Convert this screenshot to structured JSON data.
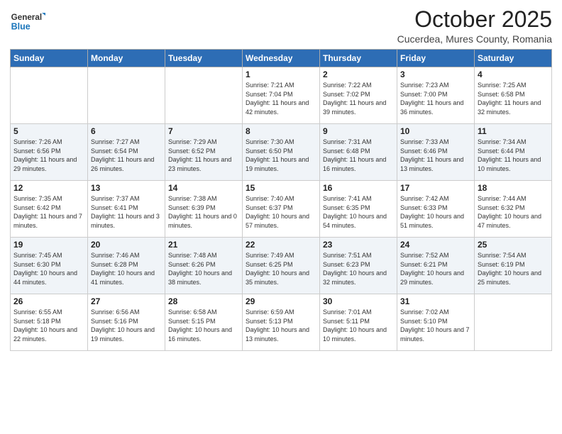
{
  "header": {
    "logo_line1": "General",
    "logo_line2": "Blue",
    "title": "October 2025",
    "subtitle": "Cucerdea, Mures County, Romania"
  },
  "columns": [
    "Sunday",
    "Monday",
    "Tuesday",
    "Wednesday",
    "Thursday",
    "Friday",
    "Saturday"
  ],
  "weeks": [
    [
      {
        "day": "",
        "sunrise": "",
        "sunset": "",
        "daylight": ""
      },
      {
        "day": "",
        "sunrise": "",
        "sunset": "",
        "daylight": ""
      },
      {
        "day": "",
        "sunrise": "",
        "sunset": "",
        "daylight": ""
      },
      {
        "day": "1",
        "sunrise": "Sunrise: 7:21 AM",
        "sunset": "Sunset: 7:04 PM",
        "daylight": "Daylight: 11 hours and 42 minutes."
      },
      {
        "day": "2",
        "sunrise": "Sunrise: 7:22 AM",
        "sunset": "Sunset: 7:02 PM",
        "daylight": "Daylight: 11 hours and 39 minutes."
      },
      {
        "day": "3",
        "sunrise": "Sunrise: 7:23 AM",
        "sunset": "Sunset: 7:00 PM",
        "daylight": "Daylight: 11 hours and 36 minutes."
      },
      {
        "day": "4",
        "sunrise": "Sunrise: 7:25 AM",
        "sunset": "Sunset: 6:58 PM",
        "daylight": "Daylight: 11 hours and 32 minutes."
      }
    ],
    [
      {
        "day": "5",
        "sunrise": "Sunrise: 7:26 AM",
        "sunset": "Sunset: 6:56 PM",
        "daylight": "Daylight: 11 hours and 29 minutes."
      },
      {
        "day": "6",
        "sunrise": "Sunrise: 7:27 AM",
        "sunset": "Sunset: 6:54 PM",
        "daylight": "Daylight: 11 hours and 26 minutes."
      },
      {
        "day": "7",
        "sunrise": "Sunrise: 7:29 AM",
        "sunset": "Sunset: 6:52 PM",
        "daylight": "Daylight: 11 hours and 23 minutes."
      },
      {
        "day": "8",
        "sunrise": "Sunrise: 7:30 AM",
        "sunset": "Sunset: 6:50 PM",
        "daylight": "Daylight: 11 hours and 19 minutes."
      },
      {
        "day": "9",
        "sunrise": "Sunrise: 7:31 AM",
        "sunset": "Sunset: 6:48 PM",
        "daylight": "Daylight: 11 hours and 16 minutes."
      },
      {
        "day": "10",
        "sunrise": "Sunrise: 7:33 AM",
        "sunset": "Sunset: 6:46 PM",
        "daylight": "Daylight: 11 hours and 13 minutes."
      },
      {
        "day": "11",
        "sunrise": "Sunrise: 7:34 AM",
        "sunset": "Sunset: 6:44 PM",
        "daylight": "Daylight: 11 hours and 10 minutes."
      }
    ],
    [
      {
        "day": "12",
        "sunrise": "Sunrise: 7:35 AM",
        "sunset": "Sunset: 6:42 PM",
        "daylight": "Daylight: 11 hours and 7 minutes."
      },
      {
        "day": "13",
        "sunrise": "Sunrise: 7:37 AM",
        "sunset": "Sunset: 6:41 PM",
        "daylight": "Daylight: 11 hours and 3 minutes."
      },
      {
        "day": "14",
        "sunrise": "Sunrise: 7:38 AM",
        "sunset": "Sunset: 6:39 PM",
        "daylight": "Daylight: 11 hours and 0 minutes."
      },
      {
        "day": "15",
        "sunrise": "Sunrise: 7:40 AM",
        "sunset": "Sunset: 6:37 PM",
        "daylight": "Daylight: 10 hours and 57 minutes."
      },
      {
        "day": "16",
        "sunrise": "Sunrise: 7:41 AM",
        "sunset": "Sunset: 6:35 PM",
        "daylight": "Daylight: 10 hours and 54 minutes."
      },
      {
        "day": "17",
        "sunrise": "Sunrise: 7:42 AM",
        "sunset": "Sunset: 6:33 PM",
        "daylight": "Daylight: 10 hours and 51 minutes."
      },
      {
        "day": "18",
        "sunrise": "Sunrise: 7:44 AM",
        "sunset": "Sunset: 6:32 PM",
        "daylight": "Daylight: 10 hours and 47 minutes."
      }
    ],
    [
      {
        "day": "19",
        "sunrise": "Sunrise: 7:45 AM",
        "sunset": "Sunset: 6:30 PM",
        "daylight": "Daylight: 10 hours and 44 minutes."
      },
      {
        "day": "20",
        "sunrise": "Sunrise: 7:46 AM",
        "sunset": "Sunset: 6:28 PM",
        "daylight": "Daylight: 10 hours and 41 minutes."
      },
      {
        "day": "21",
        "sunrise": "Sunrise: 7:48 AM",
        "sunset": "Sunset: 6:26 PM",
        "daylight": "Daylight: 10 hours and 38 minutes."
      },
      {
        "day": "22",
        "sunrise": "Sunrise: 7:49 AM",
        "sunset": "Sunset: 6:25 PM",
        "daylight": "Daylight: 10 hours and 35 minutes."
      },
      {
        "day": "23",
        "sunrise": "Sunrise: 7:51 AM",
        "sunset": "Sunset: 6:23 PM",
        "daylight": "Daylight: 10 hours and 32 minutes."
      },
      {
        "day": "24",
        "sunrise": "Sunrise: 7:52 AM",
        "sunset": "Sunset: 6:21 PM",
        "daylight": "Daylight: 10 hours and 29 minutes."
      },
      {
        "day": "25",
        "sunrise": "Sunrise: 7:54 AM",
        "sunset": "Sunset: 6:19 PM",
        "daylight": "Daylight: 10 hours and 25 minutes."
      }
    ],
    [
      {
        "day": "26",
        "sunrise": "Sunrise: 6:55 AM",
        "sunset": "Sunset: 5:18 PM",
        "daylight": "Daylight: 10 hours and 22 minutes."
      },
      {
        "day": "27",
        "sunrise": "Sunrise: 6:56 AM",
        "sunset": "Sunset: 5:16 PM",
        "daylight": "Daylight: 10 hours and 19 minutes."
      },
      {
        "day": "28",
        "sunrise": "Sunrise: 6:58 AM",
        "sunset": "Sunset: 5:15 PM",
        "daylight": "Daylight: 10 hours and 16 minutes."
      },
      {
        "day": "29",
        "sunrise": "Sunrise: 6:59 AM",
        "sunset": "Sunset: 5:13 PM",
        "daylight": "Daylight: 10 hours and 13 minutes."
      },
      {
        "day": "30",
        "sunrise": "Sunrise: 7:01 AM",
        "sunset": "Sunset: 5:11 PM",
        "daylight": "Daylight: 10 hours and 10 minutes."
      },
      {
        "day": "31",
        "sunrise": "Sunrise: 7:02 AM",
        "sunset": "Sunset: 5:10 PM",
        "daylight": "Daylight: 10 hours and 7 minutes."
      },
      {
        "day": "",
        "sunrise": "",
        "sunset": "",
        "daylight": ""
      }
    ]
  ]
}
